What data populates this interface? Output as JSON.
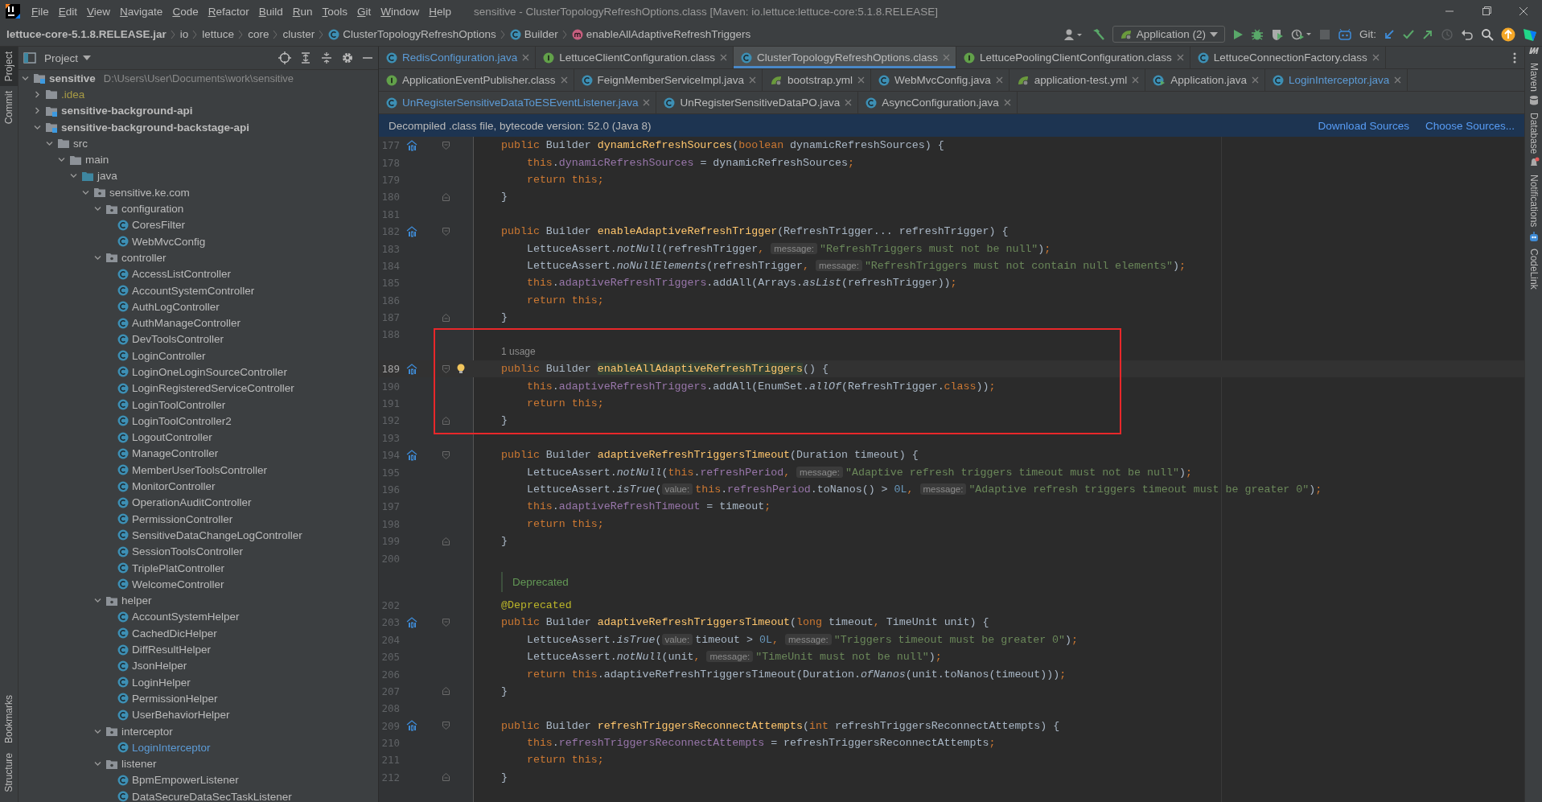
{
  "window": {
    "title": "sensitive - ClusterTopologyRefreshOptions.class [Maven: io.lettuce:lettuce-core:5.1.8.RELEASE]"
  },
  "menu": [
    "File",
    "Edit",
    "View",
    "Navigate",
    "Code",
    "Refactor",
    "Build",
    "Run",
    "Tools",
    "Git",
    "Window",
    "Help"
  ],
  "breadcrumbs": [
    {
      "label": "lettuce-core-5.1.8.RELEASE.jar",
      "kind": "jar"
    },
    {
      "label": "io",
      "kind": "plain"
    },
    {
      "label": "lettuce",
      "kind": "plain"
    },
    {
      "label": "core",
      "kind": "plain"
    },
    {
      "label": "cluster",
      "kind": "plain"
    },
    {
      "label": "ClusterTopologyRefreshOptions",
      "kind": "class"
    },
    {
      "label": "Builder",
      "kind": "class"
    },
    {
      "label": "enableAllAdaptiveRefreshTriggers",
      "kind": "method"
    }
  ],
  "toolbar": {
    "run_config": "Application (2)",
    "vcs_label": "Git:"
  },
  "left_strip": [
    {
      "label": "Project",
      "selected": true
    },
    {
      "label": "Commit",
      "selected": false
    },
    {
      "label": "Bookmarks",
      "selected": false
    },
    {
      "label": "Structure",
      "selected": false
    }
  ],
  "right_strip": [
    {
      "label": "Maven",
      "kind": "maven"
    },
    {
      "label": "Database",
      "kind": "database"
    },
    {
      "label": "Notifications",
      "kind": "bell"
    },
    {
      "label": "CodeLink",
      "kind": "robot"
    }
  ],
  "project": {
    "title": "Project",
    "tree": [
      {
        "label": "sensitive",
        "path": "D:\\Users\\User\\Documents\\work\\sensitive",
        "kind": "module",
        "expanded": true,
        "children": [
          {
            "label": ".idea",
            "kind": "folder",
            "expanded": false,
            "color": "#a89b45"
          },
          {
            "label": "sensitive-background-api",
            "kind": "module",
            "expanded": false
          },
          {
            "label": "sensitive-background-backstage-api",
            "kind": "module",
            "expanded": true,
            "children": [
              {
                "label": "src",
                "kind": "folder",
                "expanded": true,
                "children": [
                  {
                    "label": "main",
                    "kind": "folder",
                    "expanded": true,
                    "children": [
                      {
                        "label": "java",
                        "kind": "source",
                        "expanded": true,
                        "children": [
                          {
                            "label": "sensitive.ke.com",
                            "kind": "package",
                            "expanded": true,
                            "children": [
                              {
                                "label": "configuration",
                                "kind": "package",
                                "expanded": true,
                                "children": [
                                  {
                                    "label": "CoresFilter",
                                    "kind": "class"
                                  },
                                  {
                                    "label": "WebMvcConfig",
                                    "kind": "class"
                                  }
                                ]
                              },
                              {
                                "label": "controller",
                                "kind": "package",
                                "expanded": true,
                                "children": [
                                  {
                                    "label": "AccessListController",
                                    "kind": "class"
                                  },
                                  {
                                    "label": "AccountSystemController",
                                    "kind": "class"
                                  },
                                  {
                                    "label": "AuthLogController",
                                    "kind": "class"
                                  },
                                  {
                                    "label": "AuthManageController",
                                    "kind": "class"
                                  },
                                  {
                                    "label": "DevToolsController",
                                    "kind": "class"
                                  },
                                  {
                                    "label": "LoginController",
                                    "kind": "class"
                                  },
                                  {
                                    "label": "LoginOneLoginSourceController",
                                    "kind": "class"
                                  },
                                  {
                                    "label": "LoginRegisteredServiceController",
                                    "kind": "class"
                                  },
                                  {
                                    "label": "LoginToolController",
                                    "kind": "class"
                                  },
                                  {
                                    "label": "LoginToolController2",
                                    "kind": "class"
                                  },
                                  {
                                    "label": "LogoutController",
                                    "kind": "class"
                                  },
                                  {
                                    "label": "ManageController",
                                    "kind": "class"
                                  },
                                  {
                                    "label": "MemberUserToolsController",
                                    "kind": "class"
                                  },
                                  {
                                    "label": "MonitorController",
                                    "kind": "class"
                                  },
                                  {
                                    "label": "OperationAuditController",
                                    "kind": "class"
                                  },
                                  {
                                    "label": "PermissionController",
                                    "kind": "class"
                                  },
                                  {
                                    "label": "SensitiveDataChangeLogController",
                                    "kind": "class"
                                  },
                                  {
                                    "label": "SessionToolsController",
                                    "kind": "class"
                                  },
                                  {
                                    "label": "TriplePlatController",
                                    "kind": "class"
                                  },
                                  {
                                    "label": "WelcomeController",
                                    "kind": "class"
                                  }
                                ]
                              },
                              {
                                "label": "helper",
                                "kind": "package",
                                "expanded": true,
                                "children": [
                                  {
                                    "label": "AccountSystemHelper",
                                    "kind": "class"
                                  },
                                  {
                                    "label": "CachedDicHelper",
                                    "kind": "class"
                                  },
                                  {
                                    "label": "DiffResultHelper",
                                    "kind": "class"
                                  },
                                  {
                                    "label": "JsonHelper",
                                    "kind": "class"
                                  },
                                  {
                                    "label": "LoginHelper",
                                    "kind": "class"
                                  },
                                  {
                                    "label": "PermissionHelper",
                                    "kind": "class"
                                  },
                                  {
                                    "label": "UserBehaviorHelper",
                                    "kind": "class"
                                  }
                                ]
                              },
                              {
                                "label": "interceptor",
                                "kind": "package",
                                "expanded": true,
                                "children": [
                                  {
                                    "label": "LoginInterceptor",
                                    "kind": "class",
                                    "color": "#5c9bd6"
                                  }
                                ]
                              },
                              {
                                "label": "listener",
                                "kind": "package",
                                "expanded": true,
                                "children": [
                                  {
                                    "label": "BpmEmpowerListener",
                                    "kind": "class"
                                  },
                                  {
                                    "label": "DataSecureDataSecTaskListener",
                                    "kind": "class"
                                  }
                                ]
                              }
                            ]
                          }
                        ]
                      }
                    ]
                  }
                ]
              }
            ]
          }
        ]
      }
    ]
  },
  "editor": {
    "tab_rows": [
      [
        {
          "label": "RedisConfiguration.java",
          "kind": "class",
          "selected": false,
          "color": "#5c9bd6"
        },
        {
          "label": "LettuceClientConfiguration.class",
          "kind": "interface",
          "selected": false
        },
        {
          "label": "ClusterTopologyRefreshOptions.class",
          "kind": "class",
          "selected": true
        },
        {
          "label": "LettucePoolingClientConfiguration.class",
          "kind": "interface",
          "selected": false
        },
        {
          "label": "LettuceConnectionFactory.class",
          "kind": "class",
          "selected": false
        }
      ],
      [
        {
          "label": "ApplicationEventPublisher.class",
          "kind": "interface",
          "selected": false
        },
        {
          "label": "FeignMemberServiceImpl.java",
          "kind": "class",
          "selected": false
        },
        {
          "label": "bootstrap.yml",
          "kind": "spring",
          "selected": false
        },
        {
          "label": "WebMvcConfig.java",
          "kind": "class",
          "selected": false
        },
        {
          "label": "application-test.yml",
          "kind": "spring",
          "selected": false
        },
        {
          "label": "Application.java",
          "kind": "app",
          "selected": false
        },
        {
          "label": "LoginInterceptor.java",
          "kind": "class",
          "selected": false,
          "color": "#5c9bd6"
        }
      ],
      [
        {
          "label": "UnRegisterSensitiveDataToESEventListener.java",
          "kind": "class",
          "selected": false,
          "color": "#5c9bd6"
        },
        {
          "label": "UnRegisterSensitiveDataPO.java",
          "kind": "class",
          "selected": false
        },
        {
          "label": "AsyncConfiguration.java",
          "kind": "class",
          "selected": false
        }
      ]
    ],
    "banner": {
      "message": "Decompiled .class file, bytecode version: 52.0 (Java 8)",
      "links": [
        "Download Sources",
        "Choose Sources..."
      ]
    },
    "sections": [
      {
        "framed": false,
        "lines": [
          {
            "kind": "code",
            "number": "177",
            "marker": true,
            "fold_start": true,
            "tokens": [
              {
                "kind": "kw",
                "text": "public "
              },
              {
                "kind": "plain",
                "text": "Builder "
              },
              {
                "kind": "fn",
                "text": "dynamicRefreshSources"
              },
              {
                "kind": "plain",
                "text": "("
              },
              {
                "kind": "kw",
                "text": "boolean "
              },
              {
                "kind": "plain",
                "text": "dynamicRefreshSources) {"
              }
            ]
          },
          {
            "kind": "code",
            "number": "178",
            "tokens": [
              {
                "kind": "kw",
                "text": "    this"
              },
              {
                "kind": "plain",
                "text": "."
              },
              {
                "kind": "field",
                "text": "dynamicRefreshSources"
              },
              {
                "kind": "plain",
                "text": " = dynamicRefreshSources"
              },
              {
                "kind": "kw",
                "text": ";"
              }
            ]
          },
          {
            "kind": "code",
            "number": "179",
            "tokens": [
              {
                "kind": "kw",
                "text": "    return this;"
              }
            ]
          },
          {
            "kind": "code",
            "number": "180",
            "fold_end": true,
            "tokens": [
              {
                "kind": "plain",
                "text": "}"
              }
            ]
          },
          {
            "kind": "code",
            "number": "181"
          },
          {
            "kind": "code",
            "number": "182",
            "marker": true,
            "fold_start": true,
            "tokens": [
              {
                "kind": "kw",
                "text": "public "
              },
              {
                "kind": "plain",
                "text": "Builder "
              },
              {
                "kind": "fn",
                "text": "enableAdaptiveRefreshTrigger"
              },
              {
                "kind": "plain",
                "text": "(RefreshTrigger... refreshTrigger) {"
              }
            ]
          },
          {
            "kind": "code",
            "number": "183",
            "tokens": [
              {
                "kind": "plain",
                "text": "    LettuceAssert."
              },
              {
                "kind": "static",
                "text": "notNull"
              },
              {
                "kind": "plain",
                "text": "(refreshTrigger"
              },
              {
                "kind": "kw",
                "text": ", "
              },
              {
                "kind": "hint",
                "text": "message:"
              },
              {
                "kind": "str",
                "text": "\"RefreshTriggers must not be null\""
              },
              {
                "kind": "plain",
                "text": ")"
              },
              {
                "kind": "kw",
                "text": ";"
              }
            ]
          },
          {
            "kind": "code",
            "number": "184",
            "tokens": [
              {
                "kind": "plain",
                "text": "    LettuceAssert."
              },
              {
                "kind": "static",
                "text": "noNullElements"
              },
              {
                "kind": "plain",
                "text": "(refreshTrigger"
              },
              {
                "kind": "kw",
                "text": ", "
              },
              {
                "kind": "hint",
                "text": "message:"
              },
              {
                "kind": "str",
                "text": "\"RefreshTriggers must not contain null elements\""
              },
              {
                "kind": "plain",
                "text": ")"
              },
              {
                "kind": "kw",
                "text": ";"
              }
            ]
          },
          {
            "kind": "code",
            "number": "185",
            "tokens": [
              {
                "kind": "kw",
                "text": "    this"
              },
              {
                "kind": "plain",
                "text": "."
              },
              {
                "kind": "field",
                "text": "adaptiveRefreshTriggers"
              },
              {
                "kind": "plain",
                "text": ".addAll(Arrays."
              },
              {
                "kind": "static",
                "text": "asList"
              },
              {
                "kind": "plain",
                "text": "(refreshTrigger))"
              },
              {
                "kind": "kw",
                "text": ";"
              }
            ]
          },
          {
            "kind": "code",
            "number": "186",
            "tokens": [
              {
                "kind": "kw",
                "text": "    return this;"
              }
            ]
          },
          {
            "kind": "code",
            "number": "187",
            "fold_end": true,
            "tokens": [
              {
                "kind": "plain",
                "text": "}"
              }
            ]
          }
        ]
      },
      {
        "framed": true,
        "lines": [
          {
            "kind": "code",
            "number": "188"
          },
          {
            "kind": "usage",
            "text": "1 usage"
          },
          {
            "kind": "code",
            "number": "189",
            "current": true,
            "marker": true,
            "fold_start": true,
            "tokens": [
              {
                "kind": "kw",
                "text": "public "
              },
              {
                "kind": "plain",
                "text": "Builder "
              },
              {
                "kind": "fnsel",
                "text": "enableAllAdaptiveRefreshTriggers"
              },
              {
                "kind": "plain",
                "text": "() {"
              }
            ]
          },
          {
            "kind": "code",
            "number": "190",
            "tokens": [
              {
                "kind": "kw",
                "text": "    this"
              },
              {
                "kind": "plain",
                "text": "."
              },
              {
                "kind": "field",
                "text": "adaptiveRefreshTriggers"
              },
              {
                "kind": "plain",
                "text": ".addAll(EnumSet."
              },
              {
                "kind": "static",
                "text": "allOf"
              },
              {
                "kind": "plain",
                "text": "(RefreshTrigger."
              },
              {
                "kind": "kw",
                "text": "class"
              },
              {
                "kind": "plain",
                "text": "))"
              },
              {
                "kind": "kw",
                "text": ";"
              }
            ]
          },
          {
            "kind": "code",
            "number": "191",
            "tokens": [
              {
                "kind": "kw",
                "text": "    return this;"
              }
            ]
          },
          {
            "kind": "code",
            "number": "192",
            "fold_end": true,
            "tokens": [
              {
                "kind": "plain",
                "text": "}"
              }
            ]
          }
        ]
      },
      {
        "framed": false,
        "lines": [
          {
            "kind": "code",
            "number": "193"
          },
          {
            "kind": "code",
            "number": "194",
            "marker": true,
            "fold_start": true,
            "tokens": [
              {
                "kind": "kw",
                "text": "public "
              },
              {
                "kind": "plain",
                "text": "Builder "
              },
              {
                "kind": "fn",
                "text": "adaptiveRefreshTriggersTimeout"
              },
              {
                "kind": "plain",
                "text": "(Duration timeout) {"
              }
            ]
          },
          {
            "kind": "code",
            "number": "195",
            "tokens": [
              {
                "kind": "plain",
                "text": "    LettuceAssert."
              },
              {
                "kind": "static",
                "text": "notNull"
              },
              {
                "kind": "plain",
                "text": "("
              },
              {
                "kind": "kw",
                "text": "this"
              },
              {
                "kind": "plain",
                "text": "."
              },
              {
                "kind": "field",
                "text": "refreshPeriod"
              },
              {
                "kind": "kw",
                "text": ", "
              },
              {
                "kind": "hint",
                "text": "message:"
              },
              {
                "kind": "str",
                "text": "\"Adaptive refresh triggers timeout must not be null\""
              },
              {
                "kind": "plain",
                "text": ")"
              },
              {
                "kind": "kw",
                "text": ";"
              }
            ]
          },
          {
            "kind": "code",
            "number": "196",
            "tokens": [
              {
                "kind": "plain",
                "text": "    LettuceAssert."
              },
              {
                "kind": "static",
                "text": "isTrue"
              },
              {
                "kind": "plain",
                "text": "("
              },
              {
                "kind": "hint",
                "text": "value:"
              },
              {
                "kind": "kw",
                "text": "this"
              },
              {
                "kind": "plain",
                "text": "."
              },
              {
                "kind": "field",
                "text": "refreshPeriod"
              },
              {
                "kind": "plain",
                "text": ".toNanos() > "
              },
              {
                "kind": "num",
                "text": "0L"
              },
              {
                "kind": "kw",
                "text": ", "
              },
              {
                "kind": "hint",
                "text": "message:"
              },
              {
                "kind": "str",
                "text": "\"Adaptive refresh triggers timeout must be greater 0\""
              },
              {
                "kind": "plain",
                "text": ")"
              },
              {
                "kind": "kw",
                "text": ";"
              }
            ]
          },
          {
            "kind": "code",
            "number": "197",
            "tokens": [
              {
                "kind": "kw",
                "text": "    this"
              },
              {
                "kind": "plain",
                "text": "."
              },
              {
                "kind": "field",
                "text": "adaptiveRefreshTimeout"
              },
              {
                "kind": "plain",
                "text": " = timeout"
              },
              {
                "kind": "kw",
                "text": ";"
              }
            ]
          },
          {
            "kind": "code",
            "number": "198",
            "tokens": [
              {
                "kind": "kw",
                "text": "    return this;"
              }
            ]
          },
          {
            "kind": "code",
            "number": "199",
            "fold_end": true,
            "tokens": [
              {
                "kind": "plain",
                "text": "}"
              }
            ]
          },
          {
            "kind": "code",
            "number": "200"
          },
          {
            "kind": "doc",
            "text": "Deprecated"
          },
          {
            "kind": "code",
            "number": "202",
            "tokens": [
              {
                "kind": "ann",
                "text": "@Deprecated"
              }
            ]
          },
          {
            "kind": "code",
            "number": "203",
            "marker": true,
            "fold_start": true,
            "tokens": [
              {
                "kind": "kw",
                "text": "public "
              },
              {
                "kind": "plain",
                "text": "Builder "
              },
              {
                "kind": "fn",
                "text": "adaptiveRefreshTriggersTimeout"
              },
              {
                "kind": "plain",
                "text": "("
              },
              {
                "kind": "kw",
                "text": "long "
              },
              {
                "kind": "plain",
                "text": "timeout"
              },
              {
                "kind": "kw",
                "text": ", "
              },
              {
                "kind": "plain",
                "text": "TimeUnit unit) {"
              }
            ]
          },
          {
            "kind": "code",
            "number": "204",
            "tokens": [
              {
                "kind": "plain",
                "text": "    LettuceAssert."
              },
              {
                "kind": "static",
                "text": "isTrue"
              },
              {
                "kind": "plain",
                "text": "("
              },
              {
                "kind": "hint",
                "text": "value:"
              },
              {
                "kind": "plain",
                "text": "timeout > "
              },
              {
                "kind": "num",
                "text": "0L"
              },
              {
                "kind": "kw",
                "text": ", "
              },
              {
                "kind": "hint",
                "text": "message:"
              },
              {
                "kind": "str",
                "text": "\"Triggers timeout must be greater 0\""
              },
              {
                "kind": "plain",
                "text": ")"
              },
              {
                "kind": "kw",
                "text": ";"
              }
            ]
          },
          {
            "kind": "code",
            "number": "205",
            "tokens": [
              {
                "kind": "plain",
                "text": "    LettuceAssert."
              },
              {
                "kind": "static",
                "text": "notNull"
              },
              {
                "kind": "plain",
                "text": "(unit"
              },
              {
                "kind": "kw",
                "text": ", "
              },
              {
                "kind": "hint",
                "text": "message:"
              },
              {
                "kind": "str",
                "text": "\"TimeUnit must not be null\""
              },
              {
                "kind": "plain",
                "text": ")"
              },
              {
                "kind": "kw",
                "text": ";"
              }
            ]
          },
          {
            "kind": "code",
            "number": "206",
            "tokens": [
              {
                "kind": "kw",
                "text": "    return this"
              },
              {
                "kind": "plain",
                "text": ".adaptiveRefreshTriggersTimeout(Duration."
              },
              {
                "kind": "static",
                "text": "ofNanos"
              },
              {
                "kind": "plain",
                "text": "(unit.toNanos(timeout)))"
              },
              {
                "kind": "kw",
                "text": ";"
              }
            ]
          },
          {
            "kind": "code",
            "number": "207",
            "fold_end": true,
            "tokens": [
              {
                "kind": "plain",
                "text": "}"
              }
            ]
          },
          {
            "kind": "code",
            "number": "208"
          },
          {
            "kind": "code",
            "number": "209",
            "marker": true,
            "fold_start": true,
            "tokens": [
              {
                "kind": "kw",
                "text": "public "
              },
              {
                "kind": "plain",
                "text": "Builder "
              },
              {
                "kind": "fn",
                "text": "refreshTriggersReconnectAttempts"
              },
              {
                "kind": "plain",
                "text": "("
              },
              {
                "kind": "kw",
                "text": "int "
              },
              {
                "kind": "plain",
                "text": "refreshTriggersReconnectAttempts) {"
              }
            ]
          },
          {
            "kind": "code",
            "number": "210",
            "tokens": [
              {
                "kind": "kw",
                "text": "    this"
              },
              {
                "kind": "plain",
                "text": "."
              },
              {
                "kind": "field",
                "text": "refreshTriggersReconnectAttempts"
              },
              {
                "kind": "plain",
                "text": " = refreshTriggersReconnectAttempts"
              },
              {
                "kind": "kw",
                "text": ";"
              }
            ]
          },
          {
            "kind": "code",
            "number": "211",
            "tokens": [
              {
                "kind": "kw",
                "text": "    return this;"
              }
            ]
          },
          {
            "kind": "code",
            "number": "212",
            "fold_end": true,
            "tokens": [
              {
                "kind": "plain",
                "text": "}"
              }
            ]
          }
        ]
      }
    ]
  }
}
